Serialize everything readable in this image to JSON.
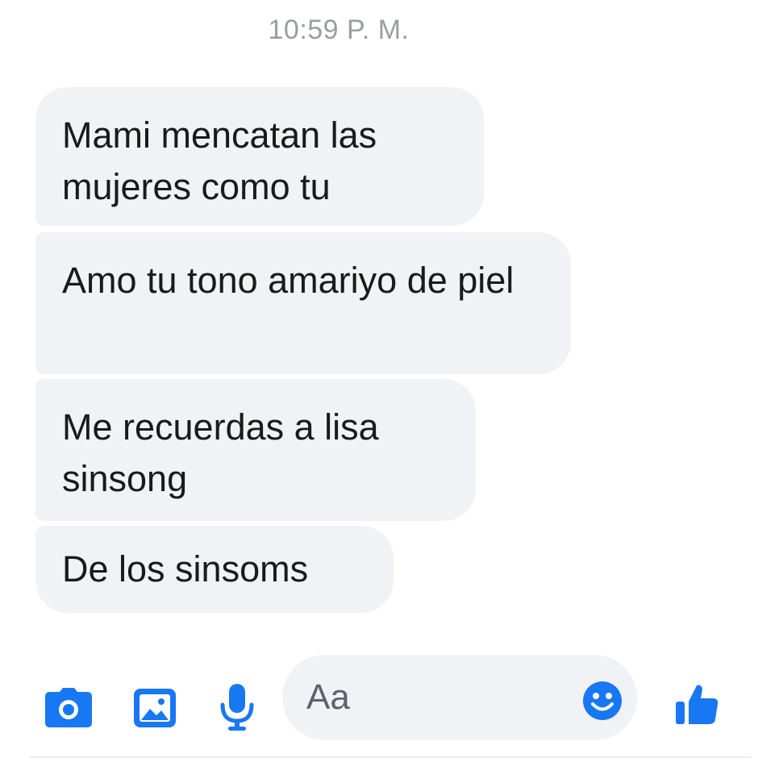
{
  "thread": {
    "timestamp": "10:59 P. M.",
    "messages": [
      {
        "text": "Mami mencatan las mujeres como tu"
      },
      {
        "text": "Amo tu tono amariyo de piel"
      },
      {
        "text": "Me recuerdas a lisa sinsong"
      },
      {
        "text": "De los sinsoms"
      }
    ]
  },
  "composer": {
    "placeholder": "Aa",
    "icons": [
      "camera-icon",
      "gallery-icon",
      "microphone-icon",
      "emoji-icon",
      "thumbs-up-icon"
    ]
  },
  "colors": {
    "accent": "#1877f2",
    "bubble": "#f1f2f6",
    "timestamp": "#9a9da3"
  }
}
